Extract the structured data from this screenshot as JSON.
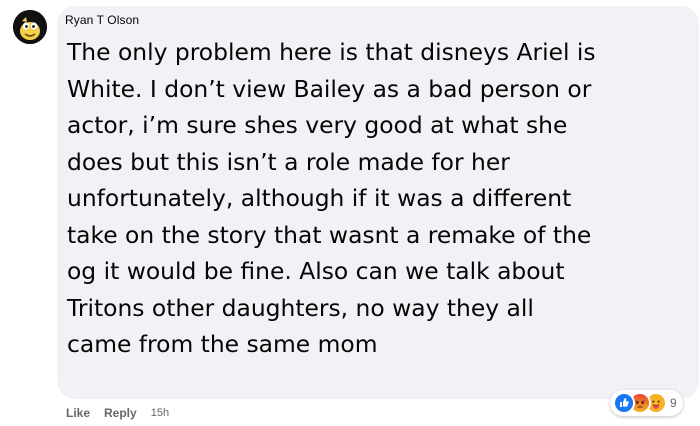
{
  "comment": {
    "author": "Ryan T Olson",
    "text": "The only problem here is that disneys Ariel is\nWhite. I don’t view Bailey as a bad person or\nactor, i’m sure shes very good at what she\ndoes but this isn’t a role made for her\nunfortunately, although if it was a different\ntake on the story that wasnt a remake of the\nog it would be fine. Also can we talk about\nTritons other daughters, no way they all\ncame from the same mom",
    "avatar_icon": "cartoon-character-avatar"
  },
  "actions": {
    "like_label": "Like",
    "reply_label": "Reply",
    "timestamp": "15h"
  },
  "reactions": {
    "icons": [
      "like-icon",
      "angry-icon",
      "care-icon"
    ],
    "count": "9"
  },
  "colors": {
    "bubble_bg": "#f0f2f5",
    "text": "#050505",
    "secondary_text": "#65676b",
    "like_blue": "#1877f2",
    "angry_orange": "#f0502a",
    "care_yellow": "#f7b125"
  }
}
